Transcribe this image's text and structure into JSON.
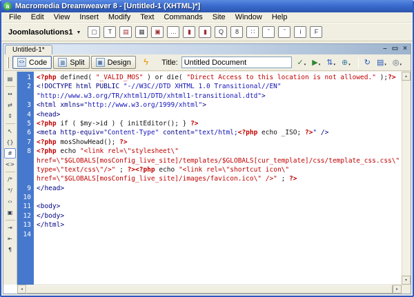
{
  "window": {
    "icon_letter": "a",
    "title": "Macromedia Dreamweaver 8 - [Untitled-1 (XHTML)*]",
    "minimize": "–",
    "restore": "▭",
    "close": "×"
  },
  "menu_items": [
    "File",
    "Edit",
    "View",
    "Insert",
    "Modify",
    "Text",
    "Commands",
    "Site",
    "Window",
    "Help"
  ],
  "insert_bar": {
    "category": "Joomlasolutions1",
    "dropdown_arrow": "▼",
    "icons": [
      {
        "name": "new-document-icon",
        "glyph": "▢",
        "color": "#444444"
      },
      {
        "name": "template-text-icon",
        "glyph": "T",
        "color": "#333333"
      },
      {
        "name": "window-bar-icon",
        "glyph": "▤",
        "color": "#a03030"
      },
      {
        "name": "table-icon",
        "glyph": "▦",
        "color": "#444444"
      },
      {
        "name": "module-box-icon",
        "glyph": "▣",
        "color": "#a03030"
      },
      {
        "name": "ellipsis-icon",
        "glyph": "…",
        "color": "#333333"
      },
      {
        "name": "red-bar-icon",
        "glyph": "▮",
        "color": "#a03030"
      },
      {
        "name": "red-bar-icon-2",
        "glyph": "▮",
        "color": "#a03030"
      },
      {
        "name": "search-icon",
        "glyph": "Q",
        "color": "#333333"
      },
      {
        "name": "number-icon",
        "glyph": "8",
        "color": "#333333"
      },
      {
        "name": "dots-icon",
        "glyph": "∷",
        "color": "#333333"
      },
      {
        "name": "caret-up-icon",
        "glyph": "ˆ",
        "color": "#333333"
      },
      {
        "name": "caret-down-icon",
        "glyph": "ˇ",
        "color": "#333333"
      },
      {
        "name": "info-icon",
        "glyph": "i",
        "color": "#333333"
      },
      {
        "name": "function-icon",
        "glyph": "F",
        "color": "#333333"
      }
    ]
  },
  "doc_window": {
    "tab_label": "Untitled-1*",
    "minimize": "–",
    "restore": "▭",
    "close": "×"
  },
  "doc_toolbar": {
    "view_buttons": [
      {
        "name": "code-view-button",
        "label": "Code",
        "glyph": "<>",
        "active": true
      },
      {
        "name": "split-view-button",
        "label": "Split",
        "glyph": "▥",
        "active": false
      },
      {
        "name": "design-view-button",
        "label": "Design",
        "glyph": "▦",
        "active": false
      }
    ],
    "live_data_glyph": "ϟ",
    "title_label": "Title:",
    "title_value": "Untitled Document",
    "right_icons": [
      {
        "name": "check-page-icon",
        "glyph": "✓",
        "color": "#2a7a2a",
        "caret": true
      },
      {
        "name": "preview-debug-icon",
        "glyph": "▶",
        "color": "#2a8a2a",
        "caret": true
      },
      {
        "name": "file-management-icon",
        "glyph": "⇅",
        "color": "#2255bb",
        "caret": true
      },
      {
        "name": "preview-browser-icon",
        "glyph": "⊕",
        "color": "#2a7aa0",
        "caret": true
      },
      {
        "name": "sep"
      },
      {
        "name": "refresh-icon",
        "glyph": "↻",
        "color": "#2255bb",
        "caret": false
      },
      {
        "name": "view-options-icon",
        "glyph": "▤",
        "color": "#2255bb",
        "caret": true
      },
      {
        "name": "visual-aids-icon",
        "glyph": "◎",
        "color": "#55607a",
        "caret": true
      }
    ]
  },
  "coding_toolbar": [
    {
      "name": "open-documents-icon",
      "glyph": "▤"
    },
    {
      "sep": true
    },
    {
      "name": "collapse-full-tag-icon",
      "glyph": "↔"
    },
    {
      "name": "collapse-selection-icon",
      "glyph": "⇄"
    },
    {
      "name": "expand-all-icon",
      "glyph": "⇕"
    },
    {
      "sep": true
    },
    {
      "name": "select-parent-tag-icon",
      "glyph": "↖"
    },
    {
      "name": "balance-braces-icon",
      "glyph": "{}"
    },
    {
      "name": "line-numbers-icon",
      "glyph": "#",
      "active": true
    },
    {
      "name": "highlight-invalid-code-icon",
      "glyph": "<>"
    },
    {
      "sep": true
    },
    {
      "name": "apply-comment-icon",
      "glyph": "/*"
    },
    {
      "name": "remove-comment-icon",
      "glyph": "*/"
    },
    {
      "name": "wrap-tag-icon",
      "glyph": "‹›"
    },
    {
      "name": "recent-snippets-icon",
      "glyph": "▣"
    },
    {
      "sep": true
    },
    {
      "name": "indent-code-icon",
      "glyph": "⇥"
    },
    {
      "name": "outdent-code-icon",
      "glyph": "⇤"
    },
    {
      "name": "format-source-code-icon",
      "glyph": "¶"
    }
  ],
  "scrollbars": {
    "up": "▴",
    "down": "▾",
    "left": "◂",
    "right": "▸"
  },
  "code": {
    "lines": [
      {
        "num": "1",
        "segs": [
          {
            "c": "p",
            "t": "<?php "
          },
          {
            "c": "k",
            "t": "defined( "
          },
          {
            "c": "s",
            "t": "\"_VALID_MOS\""
          },
          {
            "c": "k",
            "t": " ) or die( "
          },
          {
            "c": "s",
            "t": "\"Direct Access to this location is not allowed.\""
          },
          {
            "c": "k",
            "t": " );"
          },
          {
            "c": "p",
            "t": "?>"
          }
        ]
      },
      {
        "num": "2",
        "segs": [
          {
            "c": "t",
            "t": "<!DOCTYPE html PUBLIC "
          },
          {
            "c": "v",
            "t": "\"-//W3C//DTD XHTML 1.0 Transitional//EN\""
          }
        ]
      },
      {
        "num": "",
        "segs": [
          {
            "c": "v",
            "t": "\"http://www.w3.org/TR/xhtml1/DTD/xhtml1-transitional.dtd\""
          },
          {
            "c": "t",
            "t": ">"
          }
        ]
      },
      {
        "num": "3",
        "segs": [
          {
            "c": "t",
            "t": "<html xmlns="
          },
          {
            "c": "v",
            "t": "\"http://www.w3.org/1999/xhtml\""
          },
          {
            "c": "t",
            "t": ">"
          }
        ]
      },
      {
        "num": "4",
        "segs": [
          {
            "c": "t",
            "t": "<head>"
          }
        ]
      },
      {
        "num": "5",
        "segs": [
          {
            "c": "p",
            "t": "<?php "
          },
          {
            "c": "k",
            "t": "if ( $my->id ) { initEditor(); } "
          },
          {
            "c": "p",
            "t": "?>"
          }
        ]
      },
      {
        "num": "6",
        "segs": [
          {
            "c": "t",
            "t": "<meta http-equiv="
          },
          {
            "c": "v",
            "t": "\"Content-Type\""
          },
          {
            "c": "t",
            "t": " content="
          },
          {
            "c": "v",
            "t": "\"text/html;"
          },
          {
            "c": "p",
            "t": "<?php "
          },
          {
            "c": "k",
            "t": "echo _ISO; "
          },
          {
            "c": "p",
            "t": "?>"
          },
          {
            "c": "v",
            "t": "\""
          },
          {
            "c": "t",
            "t": " />"
          }
        ]
      },
      {
        "num": "7",
        "segs": [
          {
            "c": "p",
            "t": "<?php "
          },
          {
            "c": "k",
            "t": "mosShowHead(); "
          },
          {
            "c": "p",
            "t": "?>"
          }
        ]
      },
      {
        "num": "8",
        "segs": [
          {
            "c": "p",
            "t": "<?php "
          },
          {
            "c": "k",
            "t": "echo "
          },
          {
            "c": "s",
            "t": "\"<link rel=\\\"stylesheet\\\""
          }
        ]
      },
      {
        "num": "",
        "segs": [
          {
            "c": "s",
            "t": "href=\\\"$GLOBALS[mosConfig_live_site]/templates/$GLOBALS[cur_template]/css/template_css.css\\\""
          }
        ]
      },
      {
        "num": "",
        "segs": [
          {
            "c": "s",
            "t": "type=\\\"text/css\\\"/>\""
          },
          {
            "c": "k",
            "t": " ; "
          },
          {
            "c": "p",
            "t": "?>"
          },
          {
            "c": "p",
            "t": "<?php "
          },
          {
            "c": "k",
            "t": "echo "
          },
          {
            "c": "s",
            "t": "\"<link rel=\\\"shortcut icon\\\""
          }
        ]
      },
      {
        "num": "",
        "segs": [
          {
            "c": "s",
            "t": "href=\\\"$GLOBALS[mosConfig_live_site]/images/favicon.ico\\\" />\""
          },
          {
            "c": "k",
            "t": " ; "
          },
          {
            "c": "p",
            "t": "?>"
          }
        ]
      },
      {
        "num": "9",
        "segs": [
          {
            "c": "t",
            "t": "</head>"
          }
        ]
      },
      {
        "num": "10",
        "segs": []
      },
      {
        "num": "11",
        "segs": [
          {
            "c": "t",
            "t": "<body>"
          }
        ]
      },
      {
        "num": "12",
        "segs": [
          {
            "c": "t",
            "t": "</body>"
          }
        ]
      },
      {
        "num": "13",
        "segs": [
          {
            "c": "t",
            "t": "</html>"
          }
        ]
      },
      {
        "num": "14",
        "segs": []
      }
    ]
  }
}
